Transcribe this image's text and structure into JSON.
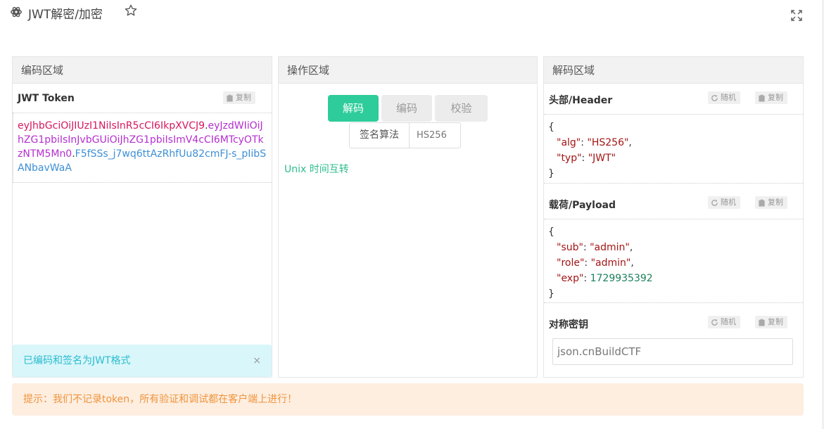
{
  "header": {
    "title": "JWT解密/加密"
  },
  "encode_panel": {
    "title": "编码区域",
    "section_title": "JWT Token",
    "copy_label": "复制",
    "token": {
      "header_part": "eyJhbGciOiJIUzI1NiIsInR5cCI6IkpXVCJ9",
      "dot1": ".",
      "payload_part": "eyJzdWIiOiJhZG1pbiIsInJvbGUiOiJhZG1pbiIsImV4cCI6MTcyOTkzNTM5Mn0",
      "dot2": ".",
      "signature_part": "F5fSSs_j7wq6ttAzRhfUu82cmFJ-s_pIibSANbavWaA"
    },
    "alert_text": "已编码和签名为JWT格式",
    "alert_close": "×"
  },
  "op_panel": {
    "title": "操作区域",
    "decode_label": "解码",
    "encode_label": "编码",
    "verify_label": "校验",
    "algo_label": "签名算法",
    "algo_value": "HS256",
    "unix_link": "Unix 时间互转"
  },
  "decode_panel": {
    "title": "解码区域",
    "header_title": "头部/Header",
    "payload_title": "载荷/Payload",
    "key_title": "对称密钥",
    "random_label": "随机",
    "copy_label": "复制",
    "header_json": {
      "open": "{",
      "alg_key": "\"alg\"",
      "alg_val": "\"HS256\"",
      "typ_key": "\"typ\"",
      "typ_val": "\"JWT\"",
      "close": "}"
    },
    "payload_json": {
      "open": "{",
      "sub_key": "\"sub\"",
      "sub_val": "\"admin\"",
      "role_key": "\"role\"",
      "role_val": "\"admin\"",
      "exp_key": "\"exp\"",
      "exp_val": "1729935392",
      "close": "}"
    },
    "key_value": "json.cnBuildCTF"
  },
  "tip": "提示：我们不记录token，所有验证和调试都在客户端上进行！",
  "icons": {
    "app": "app-settings-icon",
    "star": "star-icon",
    "expand": "expand-icon",
    "copy": "clipboard-icon",
    "random": "refresh-icon"
  },
  "colors": {
    "primary_green": "#2ecc9a",
    "token_header": "#d6175c",
    "token_payload": "#b42fcf",
    "token_signature": "#3d8fd6",
    "tip_text": "#f0943c"
  }
}
